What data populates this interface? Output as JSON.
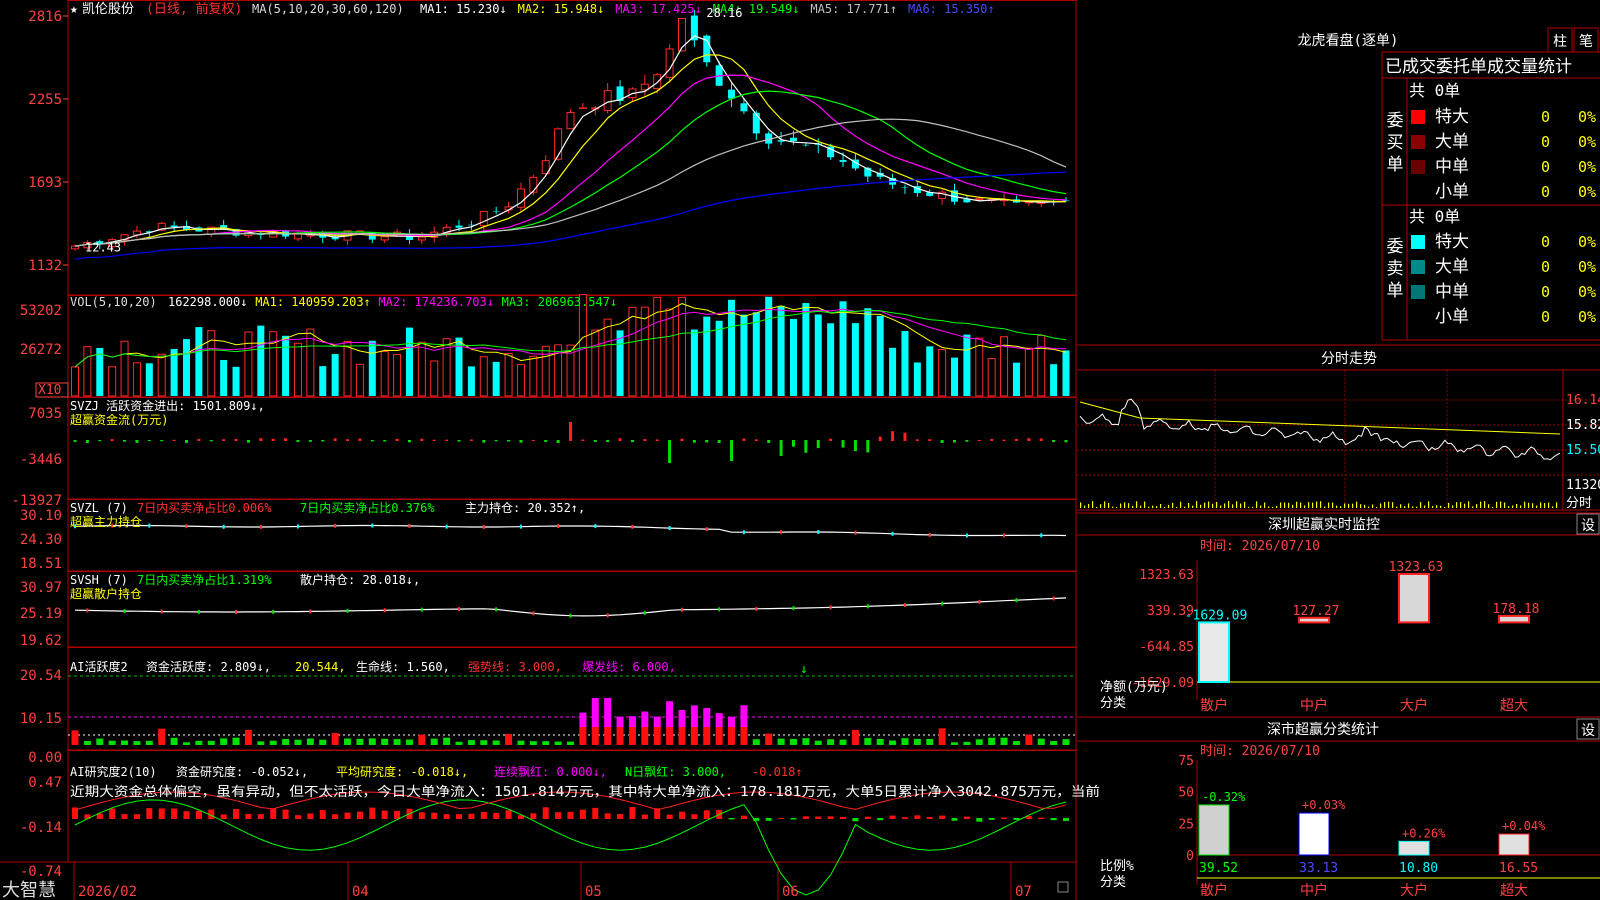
{
  "chart_data": [
    {
      "type": "candlestick",
      "name": "price",
      "stock": "凯伦股份",
      "mode_label": "(日线, 前复权)",
      "ma_header": "MA(5,10,20,30,60,120)",
      "ma_values": [
        {
          "label": "MA1:",
          "value": "15.230",
          "arrow": "↓",
          "color": "#ffffff"
        },
        {
          "label": "MA2:",
          "value": "15.948",
          "arrow": "↓",
          "color": "#ffff00"
        },
        {
          "label": "MA3:",
          "value": "17.425",
          "arrow": "↓",
          "color": "#ff00ff"
        },
        {
          "label": "MA4:",
          "value": "19.549",
          "arrow": "↓",
          "color": "#00ff00"
        },
        {
          "label": "MA5:",
          "value": "17.771",
          "arrow": "↑",
          "color": "#c0c0c0"
        },
        {
          "label": "MA6:",
          "value": "15.350",
          "arrow": "↑",
          "color": "#0000ff"
        }
      ],
      "y_ticks": [
        "2816",
        "2255",
        "1693",
        "1132"
      ],
      "y_tick_values": [
        28.16,
        22.55,
        16.93,
        11.32
      ],
      "high_label": "28.16",
      "low_label": "12.43",
      "x_ticks": [
        "2026/02",
        "04",
        "05",
        "06",
        "07"
      ]
    },
    {
      "type": "bar",
      "name": "volume",
      "header": "VOL(5,10,20)",
      "values": [
        {
          "text": "162298.000↓",
          "color": "#ffffff"
        },
        {
          "text": "MA1: 140959.203↑",
          "color": "#ffff00"
        },
        {
          "text": "MA2: 174236.703↓",
          "color": "#ff00ff"
        },
        {
          "text": "MA3: 206963.547↓",
          "color": "#00ff00"
        }
      ],
      "y_ticks": [
        "53202",
        "26272"
      ],
      "unit": "X10"
    },
    {
      "type": "bar",
      "name": "svzj",
      "line1": "SVZJ  活跃资金进出: 1501.809↓,",
      "line2": "超赢资金流(万元)",
      "y_ticks": [
        "7035",
        "-3446",
        "-13927"
      ]
    },
    {
      "type": "line",
      "name": "svzl",
      "line1a": "SVZL (7)",
      "line1b": "7日内买卖净占比0.006%",
      "line1c": "7日内买卖净占比0.376%",
      "line1d": "主力持仓: 20.352↑,",
      "line2": "超赢主力持仓",
      "y_ticks": [
        "30.10",
        "24.30",
        "18.51"
      ]
    },
    {
      "type": "line",
      "name": "svsh",
      "line1a": "SVSH (7)",
      "line1b": "7日内买卖净占比1.319%",
      "line1c": "散户持仓: 28.018↓,",
      "line2": "超赢散户持仓",
      "y_ticks": [
        "30.97",
        "25.19",
        "19.62"
      ]
    },
    {
      "type": "bar",
      "name": "ai_active",
      "line_a": "AI活跃度2",
      "line_b": "资金活跃度: 2.809↓,",
      "line_c": "20.544,",
      "line_d": "生命线: 1.560,",
      "line_e": "强势线: 3.000,",
      "line_f": "爆发线: 6.000,",
      "y_ticks": [
        "20.54",
        "10.15",
        "0.00"
      ]
    },
    {
      "type": "bar",
      "name": "ai_research",
      "line_a": "AI研究度2(10)",
      "line_b": "资金研究度: -0.052↓,",
      "line_c": "平均研究度: -0.018↓,",
      "line_d": "连续飘红: 0.000↓,",
      "line_e": "N日飘红: 3.000,",
      "line_f": "-0.018↑",
      "comment": "近期大资金总体偏空，虽有异动，但不太活跃，今日大单净流入：1501.814万元，其中特大单净流入：178.181万元，大单5日累计净入3042.875万元，当前",
      "y_ticks": [
        "0.47",
        "-0.14",
        "-0.74"
      ]
    },
    {
      "type": "line",
      "name": "intraday",
      "title": "分时走势",
      "y_ticks": [
        "16.14",
        "15.82",
        "15.50",
        "11320"
      ],
      "bottom_label": "分时"
    },
    {
      "type": "bar",
      "name": "szcy_realtime",
      "title": "深圳超赢实时监控",
      "btn": "设",
      "time": "时间: 2026/07/10",
      "categories": [
        "散户",
        "中户",
        "大户",
        "超大"
      ],
      "values": [
        -1629.09,
        127.27,
        1323.63,
        178.18
      ],
      "value_labels": [
        "-1629.09",
        "127.27",
        "1323.63",
        "178.18"
      ],
      "y_ticks": [
        "1323.63",
        "339.39",
        "-644.85",
        "-1629.09"
      ],
      "ylabel1": "净额(万元)",
      "ylabel2": "分类"
    },
    {
      "type": "bar",
      "name": "szcy_class",
      "title": "深市超赢分类统计",
      "btn": "设",
      "time": "时间: 2026/07/10",
      "categories": [
        "散户",
        "中户",
        "大户",
        "超大"
      ],
      "values": [
        39.52,
        33.13,
        10.8,
        16.55
      ],
      "value_labels": [
        "39.52",
        "33.13",
        "10.80",
        "16.55"
      ],
      "pct_labels": [
        "-0.32%",
        "+0.03%",
        "+0.26%",
        "+0.04%"
      ],
      "y_ticks": [
        "75",
        "50",
        "25",
        "0"
      ],
      "ylabel1": "比例%",
      "ylabel2": "分类"
    }
  ],
  "panel": {
    "title": "龙虎看盘(逐单)",
    "btn1": "柱",
    "btn2": "笔",
    "header": "已成交委托单成交量统计",
    "buy_label": "委买单",
    "sell_label": "委卖单",
    "buy_total": "共 0单",
    "sell_total": "共 0单",
    "rows": [
      "特大",
      "大单",
      "中单",
      "小单"
    ],
    "zero": "0",
    "pct": "0%"
  },
  "brand": "大智慧"
}
